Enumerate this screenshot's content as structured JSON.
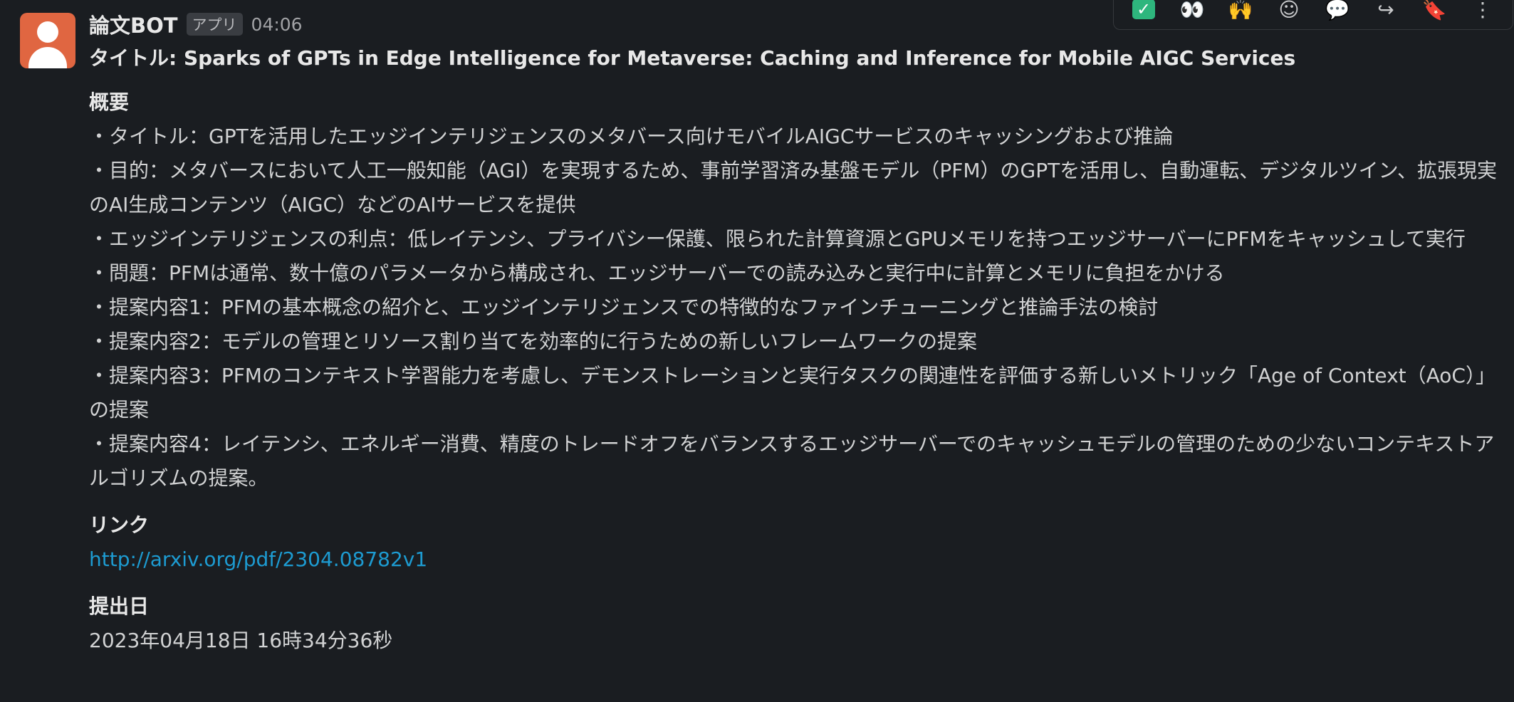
{
  "message": {
    "sender": "論文BOT",
    "app_badge": "アプリ",
    "time": "04:06",
    "title": "タイトル: Sparks of GPTs in Edge Intelligence for Metaverse: Caching and Inference for Mobile AIGC Services"
  },
  "summary": {
    "heading": "概要",
    "items": [
      "・タイトル：GPTを活用したエッジインテリジェンスのメタバース向けモバイルAIGCサービスのキャッシングおよび推論",
      "・目的：メタバースにおいて人工一般知能（AGI）を実現するため、事前学習済み基盤モデル（PFM）のGPTを活用し、自動運転、デジタルツイン、拡張現実のAI生成コンテンツ（AIGC）などのAIサービスを提供",
      "・エッジインテリジェンスの利点：低レイテンシ、プライバシー保護、限られた計算資源とGPUメモリを持つエッジサーバーにPFMをキャッシュして実行",
      "・問題：PFMは通常、数十億のパラメータから構成され、エッジサーバーでの読み込みと実行中に計算とメモリに負担をかける",
      "・提案内容1：PFMの基本概念の紹介と、エッジインテリジェンスでの特徴的なファインチューニングと推論手法の検討",
      "・提案内容2：モデルの管理とリソース割り当てを効率的に行うための新しいフレームワークの提案",
      "・提案内容3：PFMのコンテキスト学習能力を考慮し、デモンストレーションと実行タスクの関連性を評価する新しいメトリック「Age of Context（AoC）」の提案",
      "・提案内容4：レイテンシ、エネルギー消費、精度のトレードオフをバランスするエッジサーバーでのキャッシュモデルの管理のための少ないコンテキストアルゴリズムの提案。"
    ]
  },
  "link": {
    "heading": "リンク",
    "url": "http://arxiv.org/pdf/2304.08782v1"
  },
  "submitted": {
    "heading": "提出日",
    "value": "2023年04月18日 16時34分36秒"
  },
  "toolbar": {
    "buttons": [
      "check-mark-icon",
      "eyes-icon",
      "raised-hands-icon",
      "add-reaction-icon",
      "reply-in-thread-icon",
      "share-icon",
      "bookmark-icon",
      "more-actions-icon"
    ]
  },
  "colors": {
    "background": "#1a1d21",
    "text": "#d1d2d3",
    "link": "#1d9bd1",
    "avatar": "#e06641",
    "check": "#2eb67d"
  }
}
